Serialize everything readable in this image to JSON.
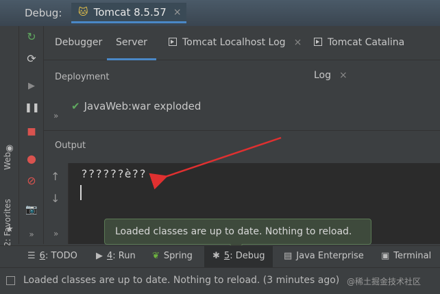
{
  "window": {
    "title_label": "Debug:",
    "active_run_tab": "Tomcat 8.5.57",
    "close_glyph": "×"
  },
  "left_stripe": {
    "web_tab": "Web",
    "favorites_tab": "2: Favorites"
  },
  "debug_tabs": [
    {
      "label": "Debugger",
      "active": false
    },
    {
      "label": "Server",
      "active": true
    },
    {
      "label": "Tomcat Localhost Log",
      "active": false,
      "closable": true
    },
    {
      "label": "Tomcat Catalina Log",
      "active": false,
      "closable": true
    }
  ],
  "deployment": {
    "label": "Deployment",
    "artifact": "JavaWeb:war exploded",
    "expand": "»"
  },
  "output": {
    "label": "Output",
    "console_text": "??????è??",
    "expand": "»"
  },
  "toast": {
    "message": "Loaded classes are up to date. Nothing to reload."
  },
  "bottom_tabs": [
    {
      "key": "6",
      "label": "TODO",
      "icon": "list-icon",
      "active": false
    },
    {
      "key": "4",
      "label": "Run",
      "icon": "play-icon",
      "active": false
    },
    {
      "key": "",
      "label": "Spring",
      "icon": "spring-leaf-icon",
      "active": false
    },
    {
      "key": "5",
      "label": "Debug",
      "icon": "bug-icon",
      "active": true
    },
    {
      "key": "",
      "label": "Java Enterprise",
      "icon": "java-enterprise-icon",
      "active": false
    },
    {
      "key": "",
      "label": "Terminal",
      "icon": "terminal-icon",
      "active": false
    }
  ],
  "status": {
    "message": "Loaded classes are up to date. Nothing to reload. (3 minutes ago)",
    "watermark": "@稀土掘金技术社区"
  },
  "colors": {
    "accent": "#4a88c7",
    "annotation_arrow": "#e03030",
    "rerun_green": "#5fa85f",
    "stop_red": "#d9534f"
  }
}
